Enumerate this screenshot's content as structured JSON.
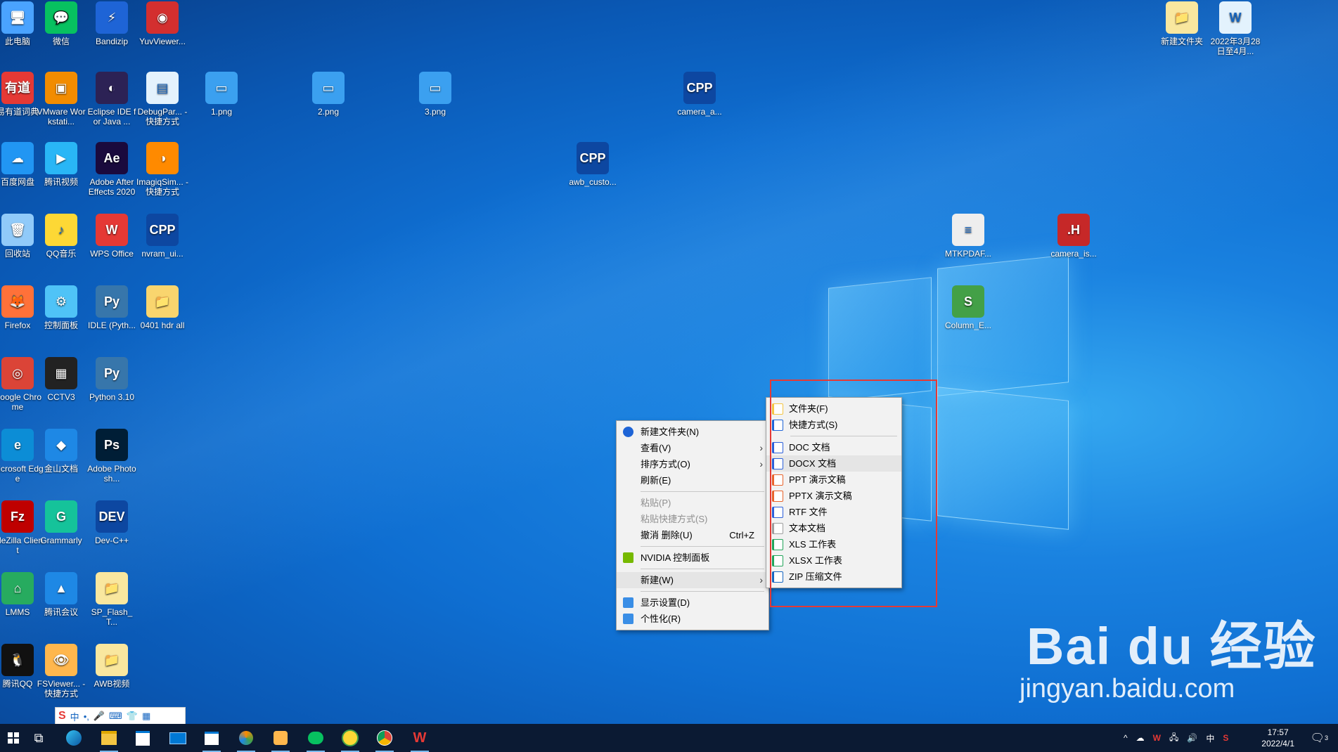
{
  "desktop": {
    "icons": [
      {
        "label": "此电脑",
        "color": "#4aa3ff",
        "glyph": "🖥"
      },
      {
        "label": "微信",
        "color": "#07c160",
        "glyph": "💬"
      },
      {
        "label": "Bandizip",
        "color": "#1e64d6",
        "glyph": "⚡"
      },
      {
        "label": "YuvViewer...",
        "color": "#d32f2f",
        "glyph": "◉"
      },
      {
        "label": "易有道词典",
        "color": "#e53935",
        "glyph": "有道"
      },
      {
        "label": "VMware Workstati...",
        "color": "#f28c00",
        "glyph": "▣"
      },
      {
        "label": "Eclipse IDE for Java ...",
        "color": "#2c2255",
        "glyph": "◐"
      },
      {
        "label": "DebugPar... - 快捷方式",
        "color": "#e3f2fd",
        "glyph": "▤"
      },
      {
        "label": "1.png",
        "color": "#3ba0f0",
        "glyph": "▭"
      },
      {
        "label": "2.png",
        "color": "#3ba0f0",
        "glyph": "▭"
      },
      {
        "label": "3.png",
        "color": "#3ba0f0",
        "glyph": "▭"
      },
      {
        "label": "camera_a...",
        "color": "#0d47a1",
        "glyph": "CPP"
      },
      {
        "label": "百度网盘",
        "color": "#2196f3",
        "glyph": "☁"
      },
      {
        "label": "腾讯视频",
        "color": "#29b6f6",
        "glyph": "▶"
      },
      {
        "label": "Adobe After Effects 2020",
        "color": "#1a0a3d",
        "glyph": "Ae"
      },
      {
        "label": "ImagiqSim... - 快捷方式",
        "color": "#ff8a00",
        "glyph": "◑"
      },
      {
        "label": "awb_custo...",
        "color": "#0d47a1",
        "glyph": "CPP"
      },
      {
        "label": "回收站",
        "color": "#90caf9",
        "glyph": "🗑"
      },
      {
        "label": "QQ音乐",
        "color": "#fdd835",
        "glyph": "♪"
      },
      {
        "label": "WPS Office",
        "color": "#e53935",
        "glyph": "W"
      },
      {
        "label": "nvram_ui...",
        "color": "#0d47a1",
        "glyph": "CPP"
      },
      {
        "label": "MTKPDAF...",
        "color": "#eeeeee",
        "glyph": "≡"
      },
      {
        "label": "camera_is...",
        "color": "#c62828",
        "glyph": ".H"
      },
      {
        "label": "Firefox",
        "color": "#ff7139",
        "glyph": "🦊"
      },
      {
        "label": "控制面板",
        "color": "#4fc3f7",
        "glyph": "⚙"
      },
      {
        "label": "IDLE (Pyth...",
        "color": "#3776ab",
        "glyph": "Py"
      },
      {
        "label": "0401 hdr all",
        "color": "#f9d56e",
        "glyph": "📁"
      },
      {
        "label": "Column_E...",
        "color": "#43a047",
        "glyph": "S"
      },
      {
        "label": "Google Chrome",
        "color": "#db4437",
        "glyph": "◎"
      },
      {
        "label": "CCTV3",
        "color": "#222222",
        "glyph": "▦"
      },
      {
        "label": "Python 3.10",
        "color": "#3776ab",
        "glyph": "Py"
      },
      {
        "label": "Microsoft Edge",
        "color": "#0c8dd6",
        "glyph": "e"
      },
      {
        "label": "金山文档",
        "color": "#1e88e5",
        "glyph": "◆"
      },
      {
        "label": "Adobe Photosh...",
        "color": "#001e36",
        "glyph": "Ps"
      },
      {
        "label": "FileZilla Client",
        "color": "#bf0000",
        "glyph": "Fz"
      },
      {
        "label": "Grammarly",
        "color": "#15c39a",
        "glyph": "G"
      },
      {
        "label": "Dev-C++",
        "color": "#0d47a1",
        "glyph": "DEV"
      },
      {
        "label": "LMMS",
        "color": "#27ab5f",
        "glyph": "⌂"
      },
      {
        "label": "腾讯会议",
        "color": "#1e88e5",
        "glyph": "▲"
      },
      {
        "label": "SP_Flash_T...",
        "color": "#f9e79f",
        "glyph": "📁"
      },
      {
        "label": "腾讯QQ",
        "color": "#111111",
        "glyph": "🐧"
      },
      {
        "label": "FSViewer... - 快捷方式",
        "color": "#ffb74d",
        "glyph": "👁"
      },
      {
        "label": "AWB视频",
        "color": "#f9e79f",
        "glyph": "📁"
      },
      {
        "label": "新建文件夹",
        "color": "#f9e79f",
        "glyph": "📁"
      },
      {
        "label": "2022年3月28日至4月...",
        "color": "#e3f2fd",
        "glyph": "W"
      }
    ]
  },
  "context_menu": {
    "items": [
      {
        "label": "新建文件夹(N)",
        "type": "item",
        "icon": "folder-add-icon"
      },
      {
        "label": "查看(V)",
        "type": "submenu"
      },
      {
        "label": "排序方式(O)",
        "type": "submenu"
      },
      {
        "label": "刷新(E)",
        "type": "item"
      },
      {
        "type": "sep"
      },
      {
        "label": "粘贴(P)",
        "type": "disabled"
      },
      {
        "label": "粘贴快捷方式(S)",
        "type": "disabled"
      },
      {
        "label": "撤消 删除(U)",
        "type": "item",
        "shortcut": "Ctrl+Z"
      },
      {
        "type": "sep"
      },
      {
        "label": "NVIDIA 控制面板",
        "type": "item",
        "icon": "nvidia-icon"
      },
      {
        "type": "sep"
      },
      {
        "label": "新建(W)",
        "type": "submenu",
        "highlight": true
      },
      {
        "type": "sep"
      },
      {
        "label": "显示设置(D)",
        "type": "item",
        "icon": "display-icon"
      },
      {
        "label": "个性化(R)",
        "type": "item",
        "icon": "personalize-icon"
      }
    ]
  },
  "new_submenu": {
    "items": [
      {
        "label": "文件夹(F)",
        "icon": "folder-icon",
        "color": "#f4c542"
      },
      {
        "label": "快捷方式(S)",
        "icon": "shortcut-icon",
        "color": "#1e64d6"
      },
      {
        "type": "sep"
      },
      {
        "label": "DOC 文档",
        "icon": "doc-icon",
        "color": "#2b5fd9"
      },
      {
        "label": "DOCX 文档",
        "icon": "docx-icon",
        "color": "#2b5fd9",
        "highlight": true
      },
      {
        "label": "PPT 演示文稿",
        "icon": "ppt-icon",
        "color": "#e8632b"
      },
      {
        "label": "PPTX 演示文稿",
        "icon": "pptx-icon",
        "color": "#e8632b"
      },
      {
        "label": "RTF 文件",
        "icon": "rtf-icon",
        "color": "#2b5fd9"
      },
      {
        "label": "文本文档",
        "icon": "txt-icon",
        "color": "#9e9e9e"
      },
      {
        "label": "XLS 工作表",
        "icon": "xls-icon",
        "color": "#22a45a"
      },
      {
        "label": "XLSX 工作表",
        "icon": "xlsx-icon",
        "color": "#22a45a"
      },
      {
        "label": "ZIP 压缩文件",
        "icon": "zip-icon",
        "color": "#1565c0"
      }
    ]
  },
  "taskbar": {
    "clock_time": "17:57",
    "clock_date": "2022/4/1",
    "ime_lang": "中",
    "notification_count": "3"
  },
  "watermark": {
    "logo": "Bai du 经验",
    "url": "jingyan.baidu.com"
  }
}
